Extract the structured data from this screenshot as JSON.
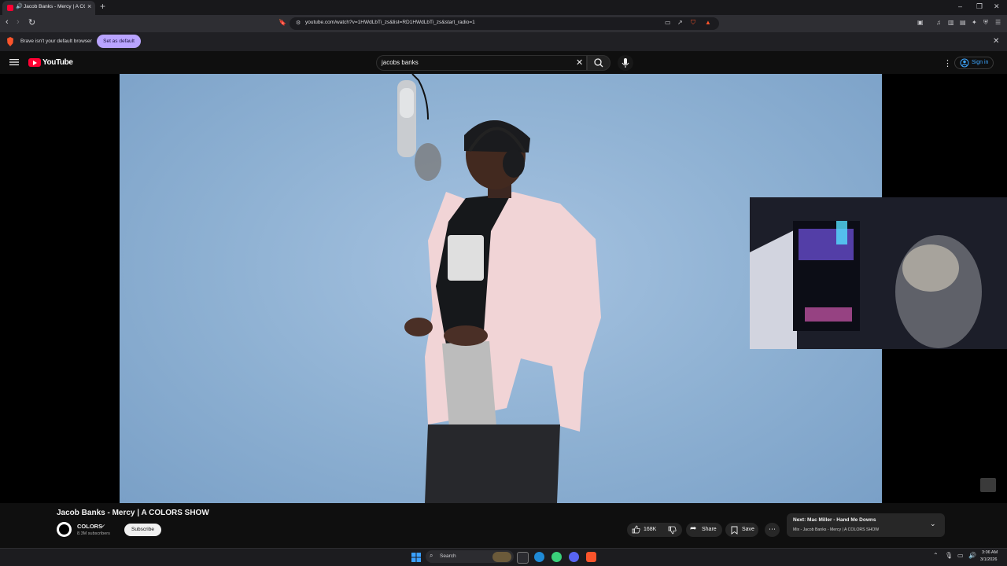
{
  "browser": {
    "tab_title": "Jacob Banks - Mercy | A COLORS SHOW",
    "url": "youtube.com/watch?v=1HWdLbTi_zs&list=RD1HWdLbTi_zs&start_radio=1",
    "shields_count": "1",
    "infobar_message": "Brave isn't your default browser",
    "set_default_label": "Set as default"
  },
  "youtube": {
    "logo_text": "YouTube",
    "search_query": "jacobs banks",
    "signin_label": "Sign in"
  },
  "video": {
    "title": "Jacob Banks - Mercy | A COLORS SHOW",
    "channel_name": "COLORS",
    "subscribers": "8.3M subscribers",
    "subscribe_label": "Subscribe",
    "like_count": "168K",
    "share_label": "Share",
    "save_label": "Save"
  },
  "up_next": {
    "title": "Next: Mac Miller - Hand Me Downs",
    "subtitle": "Mix - Jacob Banks - Mercy | A COLORS SHOW"
  },
  "taskbar": {
    "search_label": "Search",
    "time": "3:06 AM",
    "date": "3/1/2026"
  },
  "colors": {
    "youtube_red": "#ff0033",
    "brave_orange": "#fb542b",
    "set_default_bg": "#b9a4ff",
    "video_backdrop": "#8db0d2",
    "signin_blue": "#3ea6ff"
  }
}
